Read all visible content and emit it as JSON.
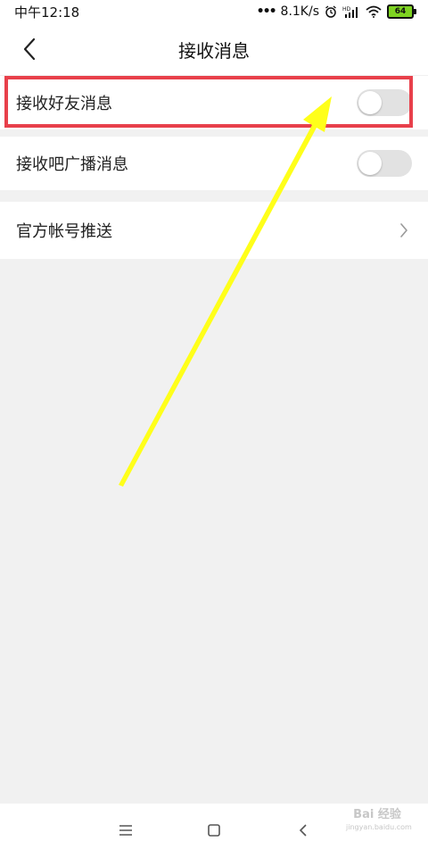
{
  "statusbar": {
    "time": "中午12:18",
    "dots": "•••",
    "network_speed": "8.1K/s",
    "battery_level": "64",
    "icons": [
      "alarm-icon",
      "hd-signal-icon",
      "wifi-icon",
      "battery-icon"
    ]
  },
  "header": {
    "title": "接收消息",
    "back_icon": "chevron-left-icon"
  },
  "settings": {
    "items": [
      {
        "label": "接收好友消息",
        "type": "toggle",
        "enabled": false
      },
      {
        "label": "接收吧广播消息",
        "type": "toggle",
        "enabled": false
      },
      {
        "label": "官方帐号推送",
        "type": "link"
      }
    ]
  },
  "annotation": {
    "highlight_color": "#e8404b",
    "arrow_color": "#ffff00"
  },
  "navbar": {
    "icons": [
      "menu-icon",
      "home-square-icon",
      "back-triangle-icon"
    ]
  },
  "watermark": {
    "main": "Bai 经验",
    "sub": "jingyan.baidu.com"
  }
}
